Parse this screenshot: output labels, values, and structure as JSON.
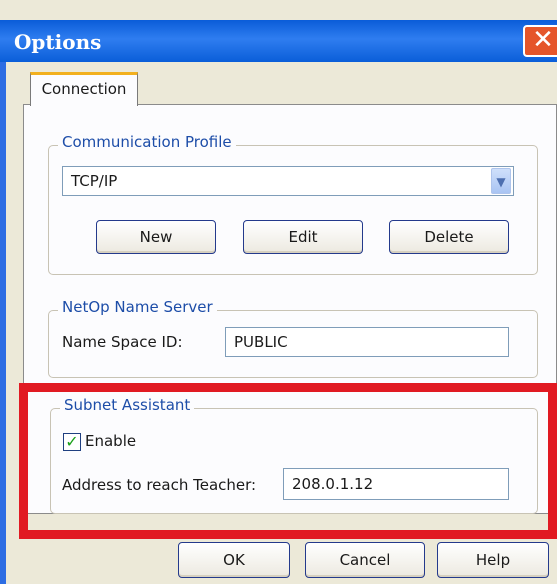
{
  "window": {
    "title": "Options",
    "close_symbol": "✕"
  },
  "tabs": [
    {
      "label": "Connection",
      "selected": true
    }
  ],
  "communication_profile": {
    "legend": "Communication Profile",
    "selected": "TCP/IP",
    "buttons": {
      "new": "New",
      "edit": "Edit",
      "delete": "Delete"
    }
  },
  "name_server": {
    "legend": "NetOp Name Server",
    "label": "Name Space ID:",
    "value": "PUBLIC"
  },
  "subnet_assistant": {
    "legend": "Subnet Assistant",
    "enable_label": "Enable",
    "enable_checked": true,
    "address_label": "Address to reach Teacher:",
    "address_value": "208.0.1.12"
  },
  "footer": {
    "ok": "OK",
    "cancel": "Cancel",
    "help": "Help"
  },
  "colors": {
    "titlebar": "#0a5cd8",
    "highlight": "#e11a22",
    "legend_text": "#1d4da8"
  }
}
